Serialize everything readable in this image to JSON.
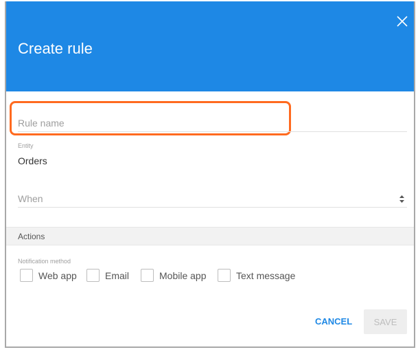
{
  "dialog": {
    "title": "Create rule"
  },
  "fields": {
    "rule_name": {
      "placeholder": "Rule name",
      "value": ""
    },
    "entity": {
      "label": "Entity",
      "value": "Orders"
    },
    "when": {
      "placeholder": "When"
    }
  },
  "actions": {
    "section_label": "Actions",
    "notification_label": "Notification method",
    "options": [
      {
        "label": "Web app",
        "checked": false
      },
      {
        "label": "Email",
        "checked": false
      },
      {
        "label": "Mobile app",
        "checked": false
      },
      {
        "label": "Text message",
        "checked": false
      }
    ]
  },
  "buttons": {
    "cancel": "CANCEL",
    "save": "SAVE"
  },
  "colors": {
    "header": "#1e88e5",
    "highlight": "#ff6a1f"
  }
}
